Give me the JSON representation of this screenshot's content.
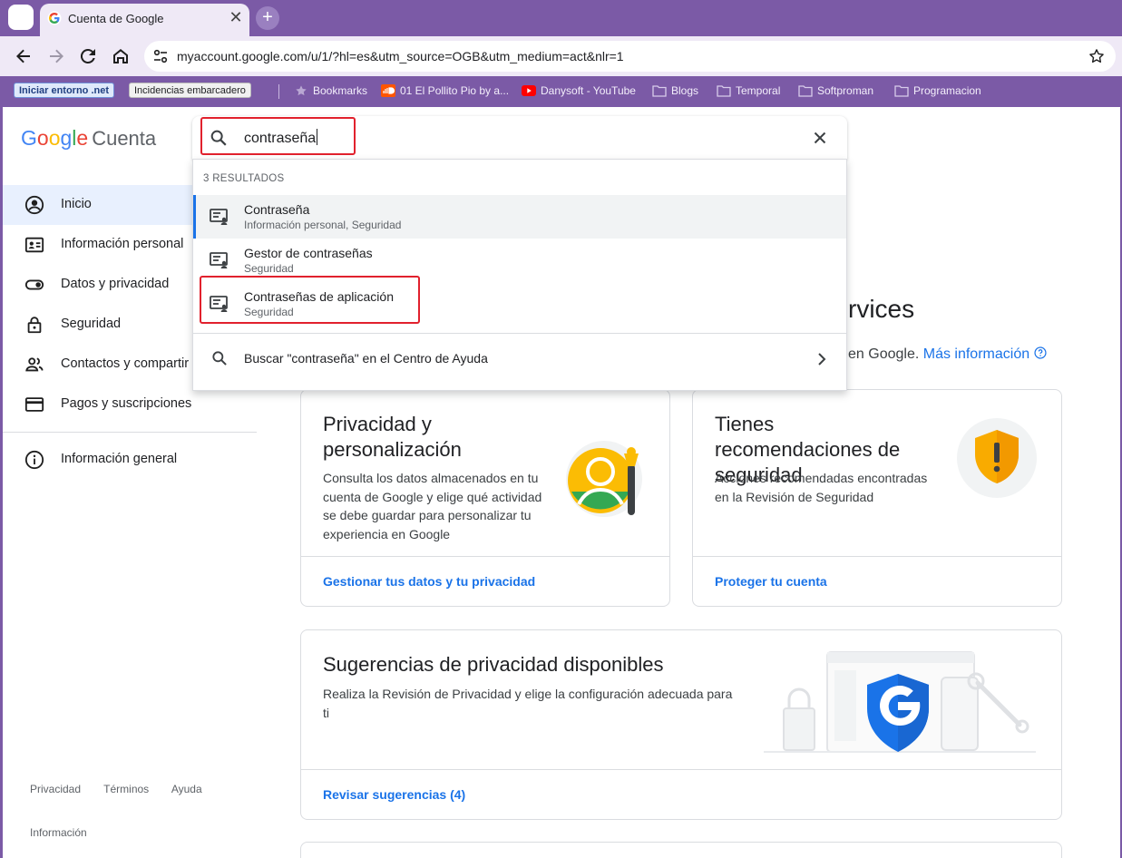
{
  "browser": {
    "tab_title": "Cuenta de Google",
    "tab_close": "✕",
    "new_tab": "+",
    "url": "myaccount.google.com/u/1/?hl=es&utm_source=OGB&utm_medium=act&nlr=1",
    "bookmarks": {
      "chip_1": "Iniciar entorno .net",
      "chip_2": "Incidencias embarcadero",
      "items": [
        "Bookmarks",
        "01 El Pollito Pio by a...",
        "Danysoft - YouTube",
        "Blogs",
        "Temporal",
        "Softproman",
        "Programacion"
      ]
    }
  },
  "header": {
    "logo_letters": [
      "G",
      "o",
      "o",
      "g",
      "l",
      "e"
    ],
    "logo_colors": [
      "#4285f4",
      "#ea4335",
      "#fbbc05",
      "#4285f4",
      "#34a853",
      "#ea4335"
    ],
    "logo_suffix": "Cuenta"
  },
  "search": {
    "value": "contraseña",
    "result_count": "3 RESULTADOS",
    "results": [
      {
        "title": "Contraseña",
        "subtitle": "Información personal, Seguridad"
      },
      {
        "title": "Gestor de contraseñas",
        "subtitle": "Seguridad"
      },
      {
        "title": "Contraseñas de aplicación",
        "subtitle": "Seguridad"
      }
    ],
    "help_text": "Buscar \"contraseña\" en el Centro de Ayuda"
  },
  "sidebar": {
    "items": [
      {
        "label": "Inicio",
        "icon": "account-circle-icon"
      },
      {
        "label": "Información personal",
        "icon": "id-card-icon"
      },
      {
        "label": "Datos y privacidad",
        "icon": "toggle-icon"
      },
      {
        "label": "Seguridad",
        "icon": "lock-icon"
      },
      {
        "label": "Contactos y compartir",
        "icon": "people-icon"
      },
      {
        "label": "Pagos y suscripciones",
        "icon": "credit-card-icon"
      }
    ],
    "general": {
      "label": "Información general",
      "icon": "info-icon"
    }
  },
  "footer": {
    "links": [
      "Privacidad",
      "Términos",
      "Ayuda"
    ],
    "info": "Información"
  },
  "main": {
    "heading_visible": "rvices",
    "sub_visible": "en Google.",
    "sub_link": "Más información",
    "cards": [
      {
        "title": "Privacidad y personalización",
        "text": "Consulta los datos almacenados en tu cuenta de Google y elige qué actividad se debe guardar para personalizar tu experiencia en Google",
        "link": "Gestionar tus datos y tu privacidad"
      },
      {
        "title": "Tienes recomendaciones de seguridad",
        "text": "Acciones recomendadas encontradas en la Revisión de Seguridad",
        "link": "Proteger tu cuenta"
      },
      {
        "title": "Sugerencias de privacidad disponibles",
        "text": "Realiza la Revisión de Privacidad y elige la configuración adecuada para ti",
        "link": "Revisar sugerencias (4)"
      }
    ]
  },
  "colors": {
    "chrome_purple": "#7b5aa6",
    "toolbar": "#efe9f6",
    "link_blue": "#1a73e8",
    "highlight_red": "#e1212d",
    "active_nav": "#e8f0fe"
  }
}
